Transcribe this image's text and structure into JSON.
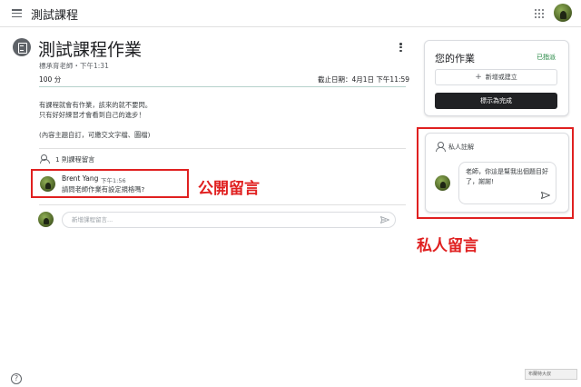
{
  "topbar": {
    "course_title": "測試課程",
    "menu_icon": "hamburger-menu-icon",
    "apps_icon": "apps-grid-icon"
  },
  "assignment": {
    "icon": "assignment-icon",
    "title": "測試課程作業",
    "meta": "標承育老師・下午1:31",
    "points": "100 分",
    "due": "截止日期：4月1日 下午11:59",
    "description": [
      "有課程就會有作業，該來的就不要閃。",
      "只有好好練習才會看到自己的進步！",
      "",
      "(內容主題自訂，可繳交文字檔、圖檔)"
    ]
  },
  "class_comments": {
    "count_label": "1 則課程留言",
    "comment": {
      "author": "Brent Yang",
      "time": "下午1:56",
      "text": "請問老師作業有設定規格嗎?"
    },
    "annotation_label": "公開留言",
    "input_placeholder": "新增課程留言..."
  },
  "your_work": {
    "title": "您的作業",
    "status": "已指派",
    "add_label": "新增或建立",
    "mark_done_label": "標示為完成"
  },
  "private_comments": {
    "title": "私人註解",
    "draft_text": "老師，你這是幫我出個題目好了，謝謝!",
    "annotation_label": "私人留言"
  },
  "footer": {
    "help": "?",
    "watermark": "布蘭特大叔"
  },
  "colors": {
    "annotation_red": "#e02020",
    "status_green": "#188038",
    "primary_dark": "#202124"
  }
}
